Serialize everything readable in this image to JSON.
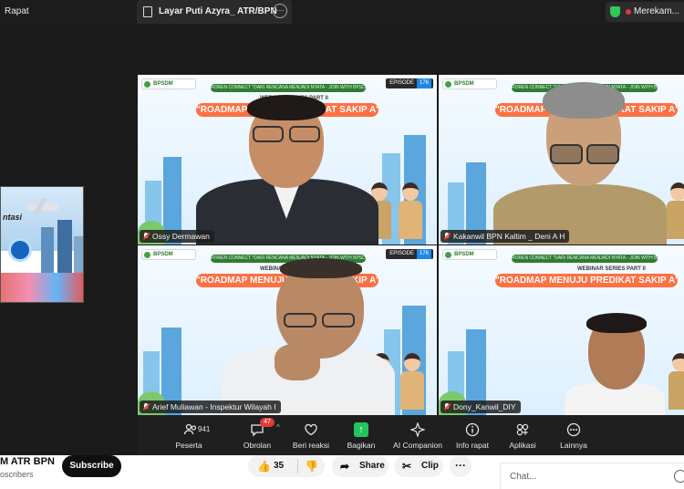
{
  "topbar": {
    "left_title": "Rapat",
    "tab_title": "Layar Puti Azyra_ ATR/BPN",
    "tab_more": "···",
    "recording_label": "Merekam..."
  },
  "shared_screen": {
    "partial_text": "ntasi"
  },
  "slide": {
    "logo_text": "BPSDM",
    "connect_text": "ROREN CONNECT \"DARI RENCANA MENJADI NYATA - JOIN WITH BPSDM\"",
    "series_text": "WEBINAR SERIES PART II",
    "roadmap_text": "\"ROADMAP MENUJU PREDIKAT SAKIP A\"",
    "episode_label": "EPISODE",
    "episode_number": "176"
  },
  "tiles": [
    {
      "name": "Ossy Dermawan",
      "muted": true,
      "active": true
    },
    {
      "name": "Kakanwil BPN Kaltim _ Deni A H",
      "muted": true,
      "active": false
    },
    {
      "name": "Arief Muliawan - Inspektur Wilayah I",
      "muted": true,
      "active": false
    },
    {
      "name": "Dony_Kanwil_DIY",
      "muted": true,
      "active": false
    }
  ],
  "toolbar": {
    "participants_label": "Peserta",
    "participants_count": "941",
    "chat_label": "Obrolan",
    "chat_badge": "47",
    "react_label": "Beri reaksi",
    "share_label": "Bagikan",
    "ai_label": "AI Companion",
    "info_label": "Info rapat",
    "apps_label": "Aplikasi",
    "more_label": "Lainnya",
    "icons": [
      "people-icon",
      "chat-icon",
      "heart-icon",
      "share-up-arrow-icon",
      "sparkle-icon",
      "info-icon",
      "apps-icon",
      "ellipsis-icon"
    ]
  },
  "youtube": {
    "channel_name": "M ATR BPN",
    "subscribers": "oscribers",
    "subscribe_label": "Subscribe",
    "likes": "35",
    "share_label": "Share",
    "clip_label": "Clip",
    "more_label": "···",
    "chat_placeholder": "Chat..."
  },
  "colors": {
    "active_speaker_border": "#34d058",
    "recording_dot": "#e53935",
    "roadmap_pill": "#ff7043",
    "share_button": "#22c55e"
  }
}
